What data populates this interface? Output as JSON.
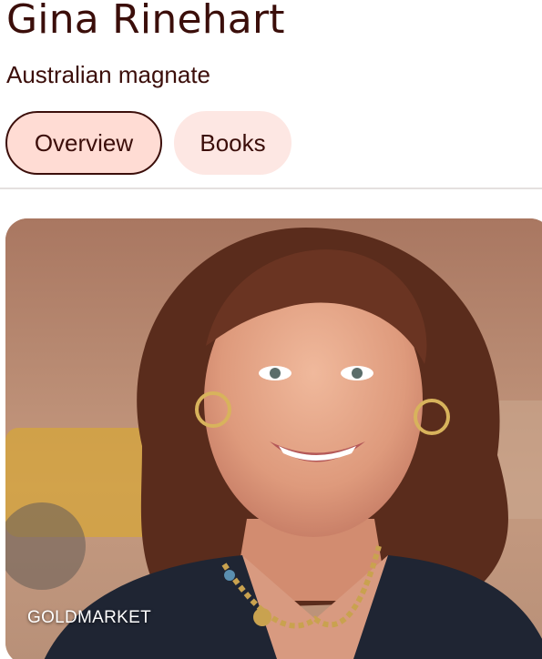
{
  "header": {
    "title": "Gina Rinehart",
    "subtitle": "Australian magnate"
  },
  "tabs": [
    {
      "label": "Overview",
      "selected": true
    },
    {
      "label": "Books",
      "selected": false
    }
  ],
  "media": {
    "image_description_icon": "person-photo",
    "source_label": "GOLDMARKET"
  },
  "colors": {
    "text": "#3b0e0a",
    "active_chip_bg": "#ffdcd4",
    "inactive_chip_bg": "#fde7e3",
    "divider": "#e4e0df"
  }
}
